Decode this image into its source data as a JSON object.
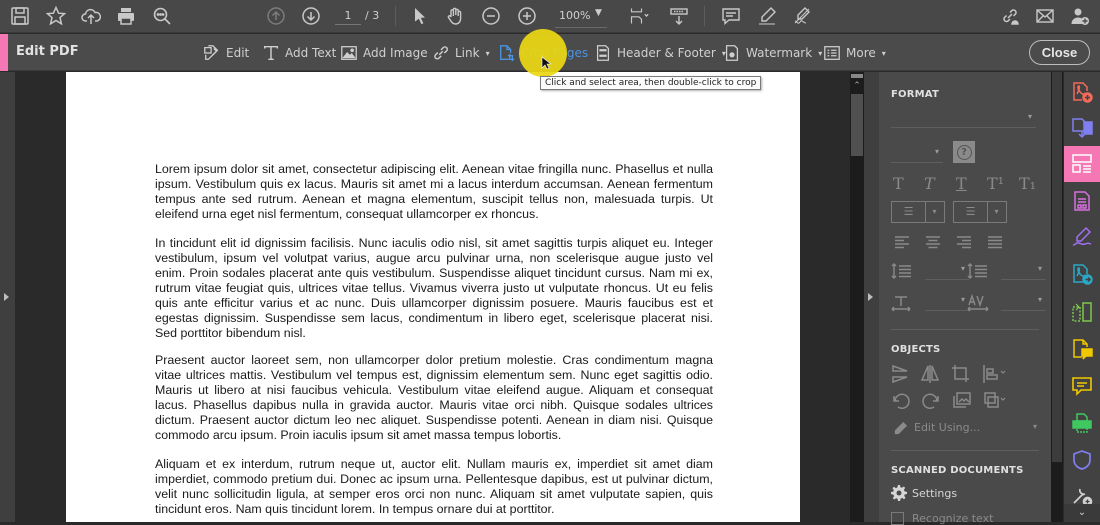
{
  "top_toolbar": {
    "icons": [
      "save-icon",
      "bookmark-star-icon",
      "cloud-upload-icon",
      "print-icon",
      "find-zoom-icon",
      "previous-page-icon",
      "next-page-icon",
      "select-pointer-icon",
      "hand-tool-icon",
      "zoom-out-icon",
      "zoom-in-icon",
      "page-fit-icon",
      "scroll-mode-icon",
      "comment-icon",
      "highlight-pen-icon",
      "sign-pen-icon",
      "share-link-icon",
      "email-icon",
      "add-user-icon"
    ],
    "current_page": "1",
    "total_pages": "/ 3",
    "zoom_level": "100%"
  },
  "edit_toolbar": {
    "title": "Edit PDF",
    "items": [
      {
        "label": "Edit",
        "icon": "edit-text-image-icon",
        "has_menu": false
      },
      {
        "label": "Add Text",
        "icon": "add-text-icon",
        "has_menu": false
      },
      {
        "label": "Add Image",
        "icon": "add-image-icon",
        "has_menu": false
      },
      {
        "label": "Link",
        "icon": "link-icon",
        "has_menu": true
      },
      {
        "label": "Crop Pages",
        "icon": "crop-pages-icon",
        "has_menu": false,
        "active": true
      },
      {
        "label": "Header & Footer",
        "icon": "header-footer-icon",
        "has_menu": true
      },
      {
        "label": "Watermark",
        "icon": "watermark-icon",
        "has_menu": true
      },
      {
        "label": "More",
        "icon": "more-icon",
        "has_menu": true
      }
    ],
    "caret": "▾",
    "close_label": "Close"
  },
  "tooltip": "Click and select area, then double-click to crop",
  "document": {
    "paragraphs": [
      "Lorem ipsum dolor sit amet, consectetur adipiscing elit. Aenean vitae fringilla nunc. Phasellus et nulla ipsum. Vestibulum quis ex lacus. Mauris sit amet mi a lacus interdum accumsan. Aenean fermentum tempus ante sed rutrum. Aenean et magna elementum, suscipit tellus non, malesuada turpis. Ut eleifend urna eget nisl fermentum, consequat ullamcorper ex rhoncus.",
      "In tincidunt elit id dignissim facilisis. Nunc iaculis odio nisl, sit amet sagittis turpis aliquet eu. Integer vestibulum, ipsum vel volutpat varius, augue arcu pulvinar urna, non scelerisque augue justo vel enim. Proin sodales placerat ante quis vestibulum. Suspendisse aliquet tincidunt cursus. Nam mi ex, rutrum vitae feugiat quis, ultrices vitae tellus. Vivamus viverra justo ut vulputate rhoncus. Ut eu felis quis ante efficitur varius et ac nunc. Duis ullamcorper dignissim posuere. Mauris faucibus est et egestas dignissim. Suspendisse sem lacus, condimentum in libero eget, scelerisque placerat nisi. Sed porttitor bibendum nisl.",
      "Praesent auctor laoreet sem, non ullamcorper dolor pretium molestie. Cras condimentum magna vitae ultrices mattis. Vestibulum vel tempus est, dignissim elementum sem. Nunc eget sagittis odio. Mauris ut libero at nisi faucibus vehicula. Vestibulum vitae eleifend augue. Aliquam et consequat lacus. Phasellus dapibus nulla in gravida auctor. Mauris vitae orci nibh. Quisque sodales ultrices dictum. Praesent auctor dictum leo nec aliquet. Suspendisse potenti. Aenean in diam nisi. Quisque commodo arcu ipsum. Proin iaculis ipsum sit amet massa tempus lobortis.",
      "Aliquam et ex interdum, rutrum neque ut, auctor elit. Nullam mauris ex, imperdiet sit amet diam imperdiet, commodo pretium dui. Donec ac ipsum urna. Pellentesque dapibus, est ut pulvinar dictum, velit nunc sollicitudin ligula, at semper eros orci non nunc. Aliquam sit amet vulputate sapien, quis tincidunt eros. Nam quis tincidunt lorem. In tempus ornare dui at porttitor."
    ]
  },
  "right_panel": {
    "format_heading": "FORMAT",
    "help_glyph": "?",
    "text_style_glyphs": [
      "T",
      "T",
      "T",
      "T¹",
      "T₁"
    ],
    "bullet_list_glyph": "☰",
    "numbered_list_glyph": "☰",
    "objects_heading": "OBJECTS",
    "edit_using_label": "Edit Using...",
    "scanned_heading": "SCANNED DOCUMENTS",
    "settings_label": "Settings",
    "recognize_text_label": "Recognize text",
    "caret": "▾"
  },
  "tool_rail": {
    "items": [
      {
        "name": "create-pdf-icon",
        "color": "#f26b5b"
      },
      {
        "name": "export-pdf-icon",
        "color": "#7f7ff0"
      },
      {
        "name": "edit-pdf-icon",
        "color": "#ffffff",
        "active": true
      },
      {
        "name": "organize-forms-icon",
        "color": "#d670e0"
      },
      {
        "name": "fill-sign-icon",
        "color": "#a070f0"
      },
      {
        "name": "send-for-review-icon",
        "color": "#2aa8c8"
      },
      {
        "name": "compare-files-icon",
        "color": "#7ec850"
      },
      {
        "name": "send-comments-icon",
        "color": "#f0c800"
      },
      {
        "name": "comment-icon",
        "color": "#f0c800"
      },
      {
        "name": "print-production-icon",
        "color": "#40c860"
      },
      {
        "name": "protect-shield-icon",
        "color": "#7f7ff0"
      },
      {
        "name": "more-tools-icon",
        "color": "#d0d0d0"
      }
    ],
    "more_glyph": "⌄"
  },
  "colors": {
    "accent_pink": "#f578b4",
    "active_blue": "#4b93e0",
    "highlight_yellow": "#ebd714"
  }
}
